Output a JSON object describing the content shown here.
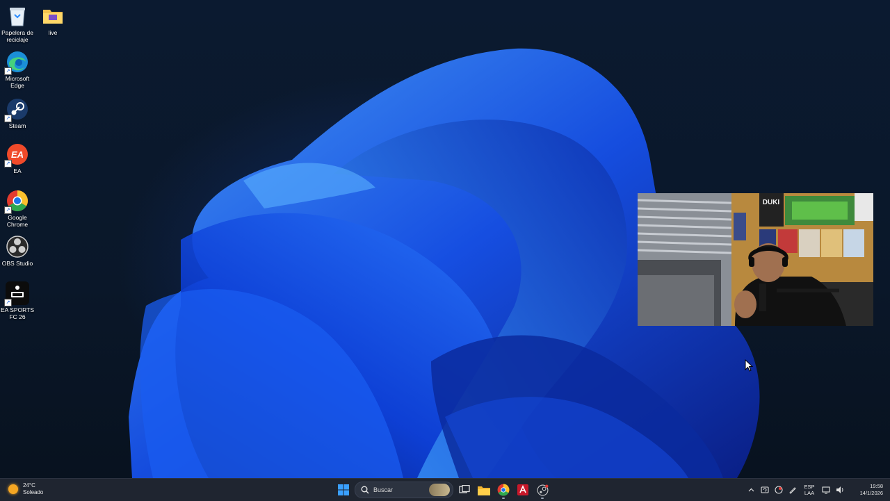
{
  "desktop": {
    "icons": [
      {
        "label": "Papelera de\nreciclaje",
        "icon": "recycle-bin-icon"
      },
      {
        "label": "live",
        "icon": "folder-icon"
      },
      {
        "label": "Microsoft\nEdge",
        "icon": "edge-icon"
      },
      {
        "label": "Steam",
        "icon": "steam-icon"
      },
      {
        "label": "EA",
        "icon": "ea-icon"
      },
      {
        "label": "Google\nChrome",
        "icon": "chrome-icon"
      },
      {
        "label": "OBS Studio",
        "icon": "obs-icon"
      },
      {
        "label": "EA SPORTS\nFC 26",
        "icon": "fc26-icon"
      }
    ],
    "webcam_poster_text": "DUKI"
  },
  "taskbar": {
    "weather": {
      "temp": "24°C",
      "condition": "Soleado"
    },
    "search_placeholder": "Buscar",
    "apps": [
      "start-icon",
      "task-view-icon",
      "file-explorer-icon",
      "chrome-icon",
      "app-icon",
      "steam-icon"
    ],
    "tray": {
      "lang_top": "ESP",
      "lang_bottom": "LAA",
      "time": "19:58",
      "date": "14/1/2026"
    }
  },
  "colors": {
    "accent": "#1e6cff",
    "taskbar_bg": "#1f2530",
    "wallpaper_bg": "#0a1729"
  }
}
